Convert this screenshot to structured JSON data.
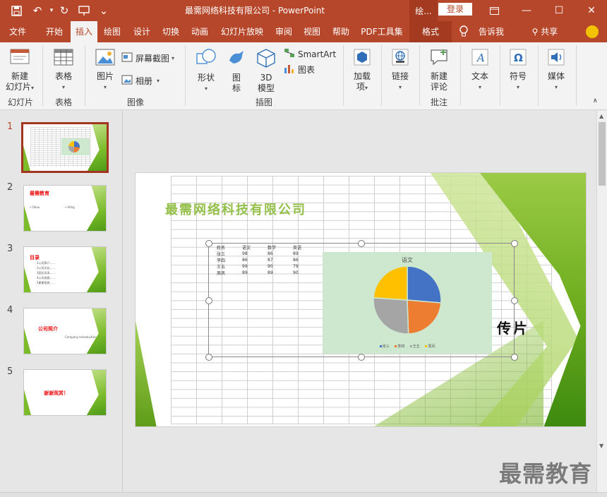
{
  "titlebar": {
    "window_title": "最需网络科技有限公司  -  PowerPoint",
    "context_label": "绘...",
    "login_label": "登录",
    "icons": [
      "save-icon",
      "undo-icon",
      "redo-icon",
      "present-icon",
      "customize-icon",
      "ribbon-display-icon",
      "minimize-icon",
      "maximize-icon",
      "close-icon"
    ],
    "undo_glyph": "↶",
    "redo_glyph": "↻",
    "customize_glyph": "⌄",
    "minimize_glyph": "—",
    "maximize_glyph": "☐",
    "close_glyph": "✕"
  },
  "tabs": [
    {
      "label": "文件"
    },
    {
      "label": "开始"
    },
    {
      "label": "插入"
    },
    {
      "label": "绘图"
    },
    {
      "label": "设计"
    },
    {
      "label": "切换"
    },
    {
      "label": "动画"
    },
    {
      "label": "幻灯片放映"
    },
    {
      "label": "审阅"
    },
    {
      "label": "视图"
    },
    {
      "label": "帮助"
    },
    {
      "label": "PDF工具集"
    },
    {
      "label": "格式"
    }
  ],
  "active_tab": "插入",
  "tell_me": "告诉我",
  "share": "共享",
  "ribbon": {
    "new_slide": {
      "line1": "新建",
      "line2": "幻灯片"
    },
    "table": "表格",
    "picture": "图片",
    "screenshot": "屏幕截图",
    "album": "相册",
    "shapes": "形状",
    "icons": {
      "line1": "图",
      "line2": "标"
    },
    "model3d": {
      "line1": "3D",
      "line2": "模型"
    },
    "smartart": "SmartArt",
    "chart": "图表",
    "addins": {
      "line1": "加载",
      "line2": "项"
    },
    "link": "链接",
    "comment": {
      "line1": "新建",
      "line2": "评论"
    },
    "text": "文本",
    "symbol": "符号",
    "media": "媒体",
    "caret": "▾",
    "groups": {
      "slides": "幻灯片",
      "tables": "表格",
      "images": "图像",
      "illustrations": "插图",
      "comments": "批注"
    }
  },
  "thumbnails": [
    {
      "number": "1",
      "title": ""
    },
    {
      "number": "2",
      "title": "最需教育",
      "sub1": "• Ohou",
      "sub2": "• Allng"
    },
    {
      "number": "3",
      "title": "目录",
      "lines": [
        "1公司简介……",
        "2公司文化……",
        "3团队风采……",
        "4公司成绩……",
        "5谢谢观赏……"
      ]
    },
    {
      "number": "4",
      "title": "公司简介",
      "sub": "Company Introduction"
    },
    {
      "number": "5",
      "title": "谢谢观赏！"
    }
  ],
  "slide": {
    "company_title": "最需网络科技有限公司",
    "side_text": "传片",
    "table": {
      "headers": [
        "姓名",
        "语文",
        "数学",
        "英语"
      ],
      "rows": [
        [
          "张三",
          "98",
          "86",
          "89"
        ],
        [
          "李四",
          "86",
          "87",
          "86"
        ],
        [
          "王五",
          "99",
          "90",
          "79"
        ],
        [
          "周凤",
          "89",
          "89",
          "90"
        ]
      ]
    }
  },
  "chart_data": {
    "type": "pie",
    "title": "语文",
    "categories": [
      "张三",
      "李四",
      "王五",
      "周凤"
    ],
    "values": [
      98,
      86,
      99,
      89
    ],
    "colors": [
      "#4472c4",
      "#ed7d31",
      "#a5a5a5",
      "#ffc000"
    ],
    "legend": "bottom"
  },
  "watermark": "最需教育",
  "scroll": {
    "up": "▲",
    "down": "▼"
  }
}
